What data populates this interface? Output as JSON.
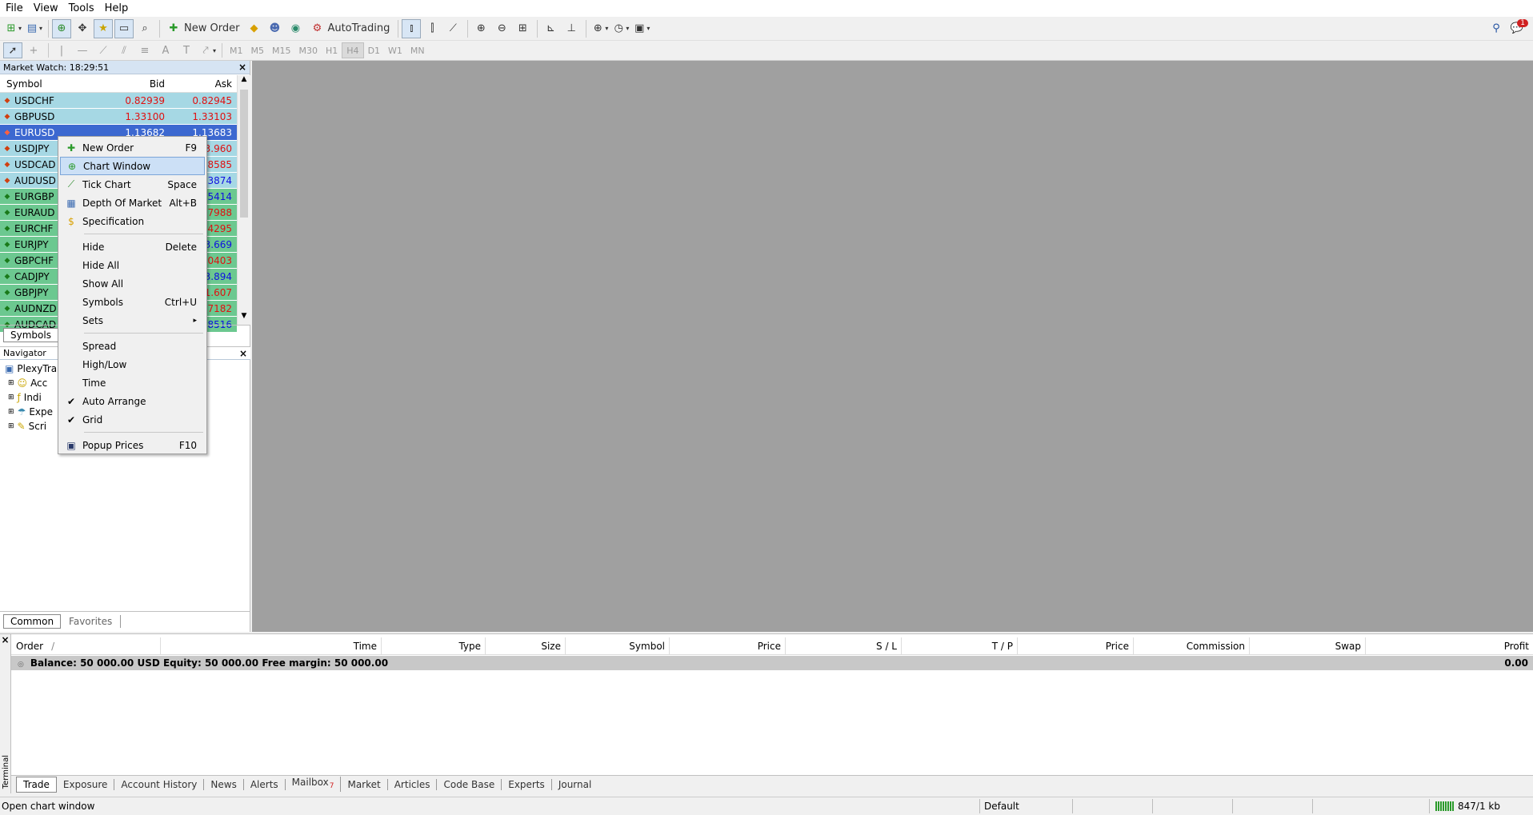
{
  "menu": [
    "File",
    "View",
    "Tools",
    "Help"
  ],
  "toolbar": {
    "new_order": "New Order",
    "autotrading": "AutoTrading",
    "alerts_count": "1"
  },
  "timeframes": [
    "M1",
    "M5",
    "M15",
    "M30",
    "H1",
    "H4",
    "D1",
    "W1",
    "MN"
  ],
  "market_watch": {
    "title": "Market Watch: 18:29:51",
    "columns": {
      "symbol": "Symbol",
      "bid": "Bid",
      "ask": "Ask"
    },
    "rows": [
      {
        "symbol": "USDCHF",
        "bid": "0.82939",
        "ask": "0.82945",
        "bg": "#a6d8e4",
        "color": "#e01010"
      },
      {
        "symbol": "GBPUSD",
        "bid": "1.33100",
        "ask": "1.33103",
        "bg": "#a6d8e4",
        "color": "#e01010"
      },
      {
        "symbol": "EURUSD",
        "bid": "1.13682",
        "ask": "1.13683",
        "bg": "#3c68d0",
        "color": "#ffffff"
      },
      {
        "symbol": "USDJPY",
        "bid": "",
        "ask": "3.960",
        "bg": "#a6d8e4",
        "color": "#e01010"
      },
      {
        "symbol": "USDCAD",
        "bid": "",
        "ask": "38585",
        "bg": "#a6d8e4",
        "color": "#e01010"
      },
      {
        "symbol": "AUDUSD",
        "bid": "",
        "ask": "53874",
        "bg": "#a6d8e4",
        "color": "#1010e0"
      },
      {
        "symbol": "EURGBP",
        "bid": "",
        "ask": "35414",
        "bg": "#6cc890",
        "color": "#1010e0"
      },
      {
        "symbol": "EURAUD",
        "bid": "",
        "ask": "77988",
        "bg": "#6cc890",
        "color": "#e01010"
      },
      {
        "symbol": "EURCHF",
        "bid": "",
        "ask": "94295",
        "bg": "#6cc890",
        "color": "#e01010"
      },
      {
        "symbol": "EURJPY",
        "bid": "",
        "ask": "3.669",
        "bg": "#6cc890",
        "color": "#1010e0"
      },
      {
        "symbol": "GBPCHF",
        "bid": "",
        "ask": "10403",
        "bg": "#6cc890",
        "color": "#e01010"
      },
      {
        "symbol": "CADJPY",
        "bid": "",
        "ask": "3.894",
        "bg": "#6cc890",
        "color": "#1010e0"
      },
      {
        "symbol": "GBPJPY",
        "bid": "",
        "ask": "1.607",
        "bg": "#6cc890",
        "color": "#e01010"
      },
      {
        "symbol": "AUDNZD",
        "bid": "",
        "ask": "07182",
        "bg": "#6cc890",
        "color": "#e01010"
      },
      {
        "symbol": "AUDCAD",
        "bid": "",
        "ask": "38516",
        "bg": "#6cc890",
        "color": "#1010e0"
      }
    ],
    "tabs": [
      "Symbols"
    ]
  },
  "navigator": {
    "title": "Navigator",
    "root": "PlexyTra",
    "items": [
      "Acc",
      "Indi",
      "Expe",
      "Scri"
    ],
    "tabs": [
      "Common",
      "Favorites"
    ]
  },
  "context_menu": {
    "groups": [
      [
        {
          "label": "New Order",
          "shortcut": "F9",
          "icon": "new-order-icon"
        },
        {
          "label": "Chart Window",
          "shortcut": "",
          "icon": "chart-window-icon",
          "selected": true
        },
        {
          "label": "Tick Chart",
          "shortcut": "Space",
          "icon": "tick-chart-icon"
        },
        {
          "label": "Depth Of Market",
          "shortcut": "Alt+B",
          "icon": "depth-of-market-icon"
        },
        {
          "label": "Specification",
          "shortcut": "",
          "icon": "specification-icon"
        }
      ],
      [
        {
          "label": "Hide",
          "shortcut": "Delete"
        },
        {
          "label": "Hide All",
          "shortcut": ""
        },
        {
          "label": "Show All",
          "shortcut": ""
        },
        {
          "label": "Symbols",
          "shortcut": "Ctrl+U"
        },
        {
          "label": "Sets",
          "shortcut": "",
          "submenu": true
        }
      ],
      [
        {
          "label": "Spread",
          "shortcut": ""
        },
        {
          "label": "High/Low",
          "shortcut": ""
        },
        {
          "label": "Time",
          "shortcut": ""
        },
        {
          "label": "Auto Arrange",
          "shortcut": "",
          "checked": true
        },
        {
          "label": "Grid",
          "shortcut": "",
          "checked": true
        }
      ],
      [
        {
          "label": "Popup Prices",
          "shortcut": "F10",
          "icon": "popup-prices-icon"
        }
      ]
    ]
  },
  "terminal": {
    "side_label": "Terminal",
    "columns": [
      "Order",
      "Time",
      "Type",
      "Size",
      "Symbol",
      "Price",
      "S / L",
      "T / P",
      "Price",
      "Commission",
      "Swap",
      "Profit"
    ],
    "sort_indicator": "/",
    "balance_text": "Balance: 50 000.00 USD  Equity: 50 000.00  Free margin: 50 000.00",
    "profit": "0.00",
    "tabs": [
      "Trade",
      "Exposure",
      "Account History",
      "News",
      "Alerts",
      "Mailbox",
      "Market",
      "Articles",
      "Code Base",
      "Experts",
      "Journal"
    ],
    "mailbox_count": "7"
  },
  "status": {
    "message": "Open chart window",
    "profile": "Default",
    "traffic": "847/1 kb"
  }
}
